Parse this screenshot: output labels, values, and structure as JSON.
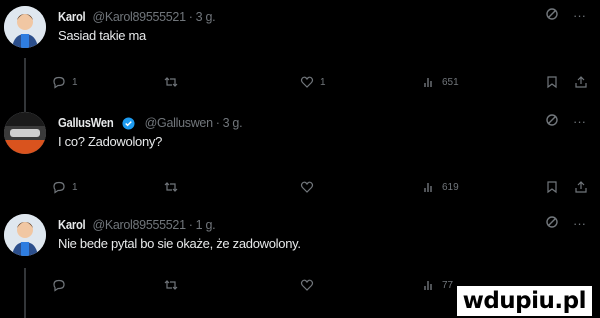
{
  "tweets": [
    {
      "name": "Karol",
      "handle": "@Karol89555521",
      "time": "3 g.",
      "verified": false,
      "text": "Sasiad takie ma",
      "replies": "1",
      "retweets": "",
      "likes": "1",
      "views": "651"
    },
    {
      "name": "GallusWen",
      "handle": "@Galluswen",
      "time": "3 g.",
      "verified": true,
      "text": "I co? Zadowolony?",
      "replies": "1",
      "retweets": "",
      "likes": "",
      "views": "619"
    },
    {
      "name": "Karol",
      "handle": "@Karol89555521",
      "time": "1 g.",
      "verified": false,
      "text": "Nie bede pytal bo sie okaże, że zadowolony.",
      "replies": "",
      "retweets": "",
      "likes": "",
      "views": "77"
    }
  ],
  "meta": {
    "dot": "·",
    "more": "···"
  },
  "colors": {
    "background": "#000000",
    "text": "#e7e9ea",
    "muted": "#71767b",
    "verified": "#1d9bf0"
  },
  "icons": [
    "grok-icon",
    "more-icon",
    "reply-icon",
    "retweet-icon",
    "like-icon",
    "views-icon",
    "bookmark-icon",
    "share-icon",
    "verified-badge-icon"
  ],
  "watermark": "wdupiu.pl"
}
